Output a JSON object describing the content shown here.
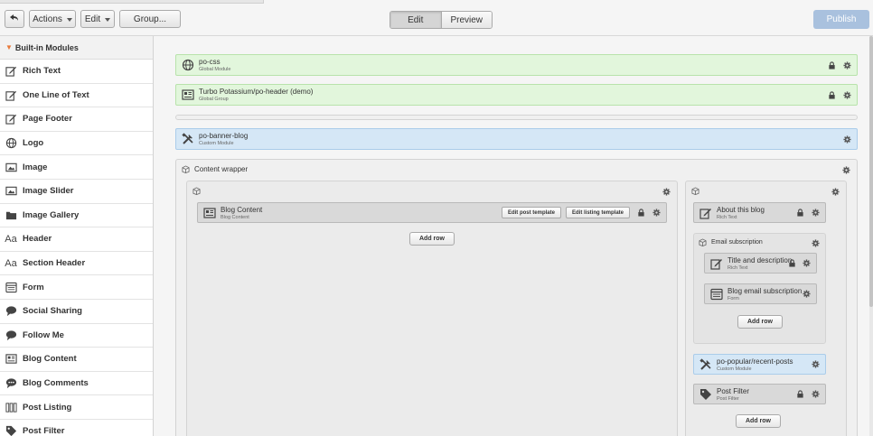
{
  "toolbar": {
    "back_icon": "back-arrow-icon",
    "actions_label": "Actions",
    "edit_label": "Edit",
    "group_label": "Group...",
    "mode_edit": "Edit",
    "mode_preview": "Preview",
    "publish_label": "Publish"
  },
  "sidebar": {
    "header": "Built-in Modules",
    "items": [
      {
        "label": "Rich Text",
        "icon": "edit-icon"
      },
      {
        "label": "One Line of Text",
        "icon": "edit-icon"
      },
      {
        "label": "Page Footer",
        "icon": "edit-icon"
      },
      {
        "label": "Logo",
        "icon": "globe-icon"
      },
      {
        "label": "Image",
        "icon": "image-icon"
      },
      {
        "label": "Image Slider",
        "icon": "image-icon"
      },
      {
        "label": "Image Gallery",
        "icon": "folder-icon"
      },
      {
        "label": "Header",
        "icon": "text-icon"
      },
      {
        "label": "Section Header",
        "icon": "text-icon"
      },
      {
        "label": "Form",
        "icon": "form-icon"
      },
      {
        "label": "Social Sharing",
        "icon": "speech-bubble-icon"
      },
      {
        "label": "Follow Me",
        "icon": "speech-bubble-icon"
      },
      {
        "label": "Blog Content",
        "icon": "blog-content-icon"
      },
      {
        "label": "Blog Comments",
        "icon": "comments-icon"
      },
      {
        "label": "Post Listing",
        "icon": "post-listing-icon"
      },
      {
        "label": "Post Filter",
        "icon": "tag-icon"
      }
    ]
  },
  "modules": {
    "po_css": {
      "name": "po-css",
      "type": "Global Module"
    },
    "po_header": {
      "name": "Turbo Potassium/po-header (demo)",
      "type": "Global Group"
    },
    "po_banner": {
      "name": "po-banner-blog",
      "type": "Custom Module"
    }
  },
  "content_wrapper": {
    "title": "Content wrapper",
    "blog_content": {
      "name": "Blog Content",
      "type": "Blog Content"
    },
    "edit_post_template": "Edit post template",
    "edit_listing_template": "Edit listing template",
    "add_row": "Add row"
  },
  "right_column": {
    "about": {
      "name": "About this blog",
      "type": "Rich Text"
    },
    "email_group_title": "Email subscription",
    "title_desc": {
      "name": "Title and description",
      "type": "Rich Text"
    },
    "blog_email": {
      "name": "Blog email subscription",
      "type": "Form"
    },
    "add_row_inner": "Add row",
    "popular": {
      "name": "po-popular/recent-posts",
      "type": "Custom Module"
    },
    "post_filter": {
      "name": "Post Filter",
      "type": "Post Filter"
    },
    "add_row": "Add row"
  },
  "colors": {
    "global": "#e2f6dc",
    "custom": "#d5e7f6",
    "builtin": "#d9d9d9",
    "publish": "#a9c1de",
    "accent": "#e8793a"
  }
}
